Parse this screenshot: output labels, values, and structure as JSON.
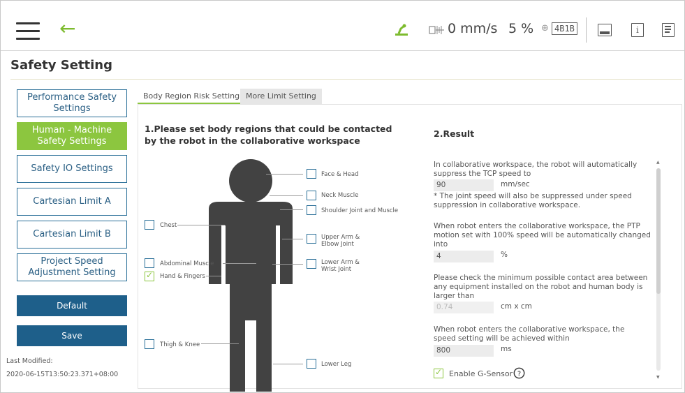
{
  "topbar": {
    "speed": "0 mm/s",
    "percent": "5 %",
    "code": "4B1B"
  },
  "page": {
    "title": "Safety Setting"
  },
  "sidebar": {
    "items": [
      {
        "label": "Performance Safety Settings",
        "active": false
      },
      {
        "label": "Human - Machine Safety Settings",
        "active": true
      },
      {
        "label": "Safety IO Settings",
        "active": false
      },
      {
        "label": "Cartesian Limit A",
        "active": false
      },
      {
        "label": "Cartesian Limit B",
        "active": false
      },
      {
        "label": "Project Speed Adjustment Setting",
        "active": false
      }
    ],
    "default_label": "Default",
    "save_label": "Save",
    "last_modified_label": "Last Modified:",
    "last_modified_value": "2020-06-15T13:50:23.371+08:00"
  },
  "tabs": [
    {
      "label": "Body Region Risk Setting",
      "active": true
    },
    {
      "label": "More Limit Setting",
      "active": false
    }
  ],
  "body_section": {
    "title": "1.Please set body regions that could be contacted by the robot in the collaborative workspace",
    "regions": {
      "face_head": {
        "label": "Face & Head",
        "checked": false
      },
      "neck_muscle": {
        "label": "Neck Muscle",
        "checked": false
      },
      "shoulder": {
        "label": "Shoulder Joint and Muscle",
        "checked": false
      },
      "chest": {
        "label": "Chest",
        "checked": false
      },
      "upper_arm": {
        "label": "Upper Arm & Elbow Joint",
        "checked": false
      },
      "abdominal": {
        "label": "Abdominal Muscle",
        "checked": false
      },
      "lower_arm": {
        "label": "Lower Arm & Wrist Joint",
        "checked": false
      },
      "hand": {
        "label": "Hand & Fingers",
        "checked": true
      },
      "thigh": {
        "label": "Thigh & Knee",
        "checked": false
      },
      "lower_leg": {
        "label": "Lower Leg",
        "checked": false
      }
    }
  },
  "result_section": {
    "title": "2.Result",
    "tcp_text": "In collaborative workspace, the robot will automatically suppress the TCP speed to",
    "tcp_value": "90",
    "tcp_unit": "mm/sec",
    "tcp_note": "* The joint speed will also be suppressed under speed suppression in collaborative workspace.",
    "ptp_text": "When robot enters the collaborative workspace, the PTP motion set with 100% speed will be automatically changed into",
    "ptp_value": "4",
    "ptp_unit": "%",
    "area_text": "Please check the minimum possible contact area between any equipment installed on the robot and human body is larger than",
    "area_value": "0.74",
    "area_unit": "cm x cm",
    "time_text": "When robot enters the collaborative workspace, the speed setting will be achieved within",
    "time_value": "800",
    "time_unit": "ms",
    "gsensor_label": "Enable G-Sensor",
    "gsensor_checked": true
  },
  "colors": {
    "accent_green": "#8cc63f",
    "primary_blue": "#1e5f8a"
  }
}
